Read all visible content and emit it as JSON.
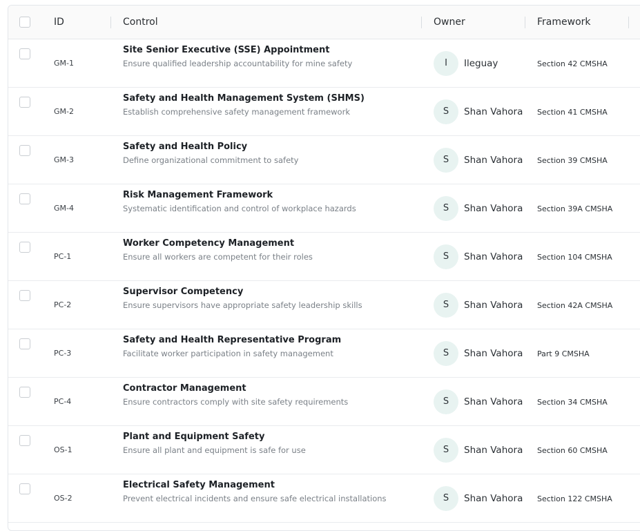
{
  "table": {
    "headers": {
      "id": "ID",
      "control": "Control",
      "owner": "Owner",
      "framework": "Framework"
    },
    "rows": [
      {
        "id": "GM-1",
        "title": "Site Senior Executive (SSE) Appointment",
        "description": "Ensure qualified leadership accountability for mine safety",
        "owner_initial": "I",
        "owner": "Ileguay",
        "framework": "Section 42 CMSHA"
      },
      {
        "id": "GM-2",
        "title": "Safety and Health Management System (SHMS)",
        "description": "Establish comprehensive safety management framework",
        "owner_initial": "S",
        "owner": "Shan Vahora",
        "framework": "Section 41 CMSHA"
      },
      {
        "id": "GM-3",
        "title": "Safety and Health Policy",
        "description": "Define organizational commitment to safety",
        "owner_initial": "S",
        "owner": "Shan Vahora",
        "framework": "Section 39 CMSHA"
      },
      {
        "id": "GM-4",
        "title": "Risk Management Framework",
        "description": "Systematic identification and control of workplace hazards",
        "owner_initial": "S",
        "owner": "Shan Vahora",
        "framework": "Section 39A CMSHA"
      },
      {
        "id": "PC-1",
        "title": "Worker Competency Management",
        "description": "Ensure all workers are competent for their roles",
        "owner_initial": "S",
        "owner": "Shan Vahora",
        "framework": "Section 104 CMSHA"
      },
      {
        "id": "PC-2",
        "title": "Supervisor Competency",
        "description": "Ensure supervisors have appropriate safety leadership skills",
        "owner_initial": "S",
        "owner": "Shan Vahora",
        "framework": "Section 42A CMSHA"
      },
      {
        "id": "PC-3",
        "title": "Safety and Health Representative Program",
        "description": "Facilitate worker participation in safety management",
        "owner_initial": "S",
        "owner": "Shan Vahora",
        "framework": "Part 9 CMSHA"
      },
      {
        "id": "PC-4",
        "title": "Contractor Management",
        "description": "Ensure contractors comply with site safety requirements",
        "owner_initial": "S",
        "owner": "Shan Vahora",
        "framework": "Section 34 CMSHA"
      },
      {
        "id": "OS-1",
        "title": "Plant and Equipment Safety",
        "description": "Ensure all plant and equipment is safe for use",
        "owner_initial": "S",
        "owner": "Shan Vahora",
        "framework": "Section 60 CMSHA"
      },
      {
        "id": "OS-2",
        "title": "Electrical Safety Management",
        "description": "Prevent electrical incidents and ensure safe electrical installations",
        "owner_initial": "S",
        "owner": "Shan Vahora",
        "framework": "Section 122 CMSHA"
      }
    ]
  }
}
